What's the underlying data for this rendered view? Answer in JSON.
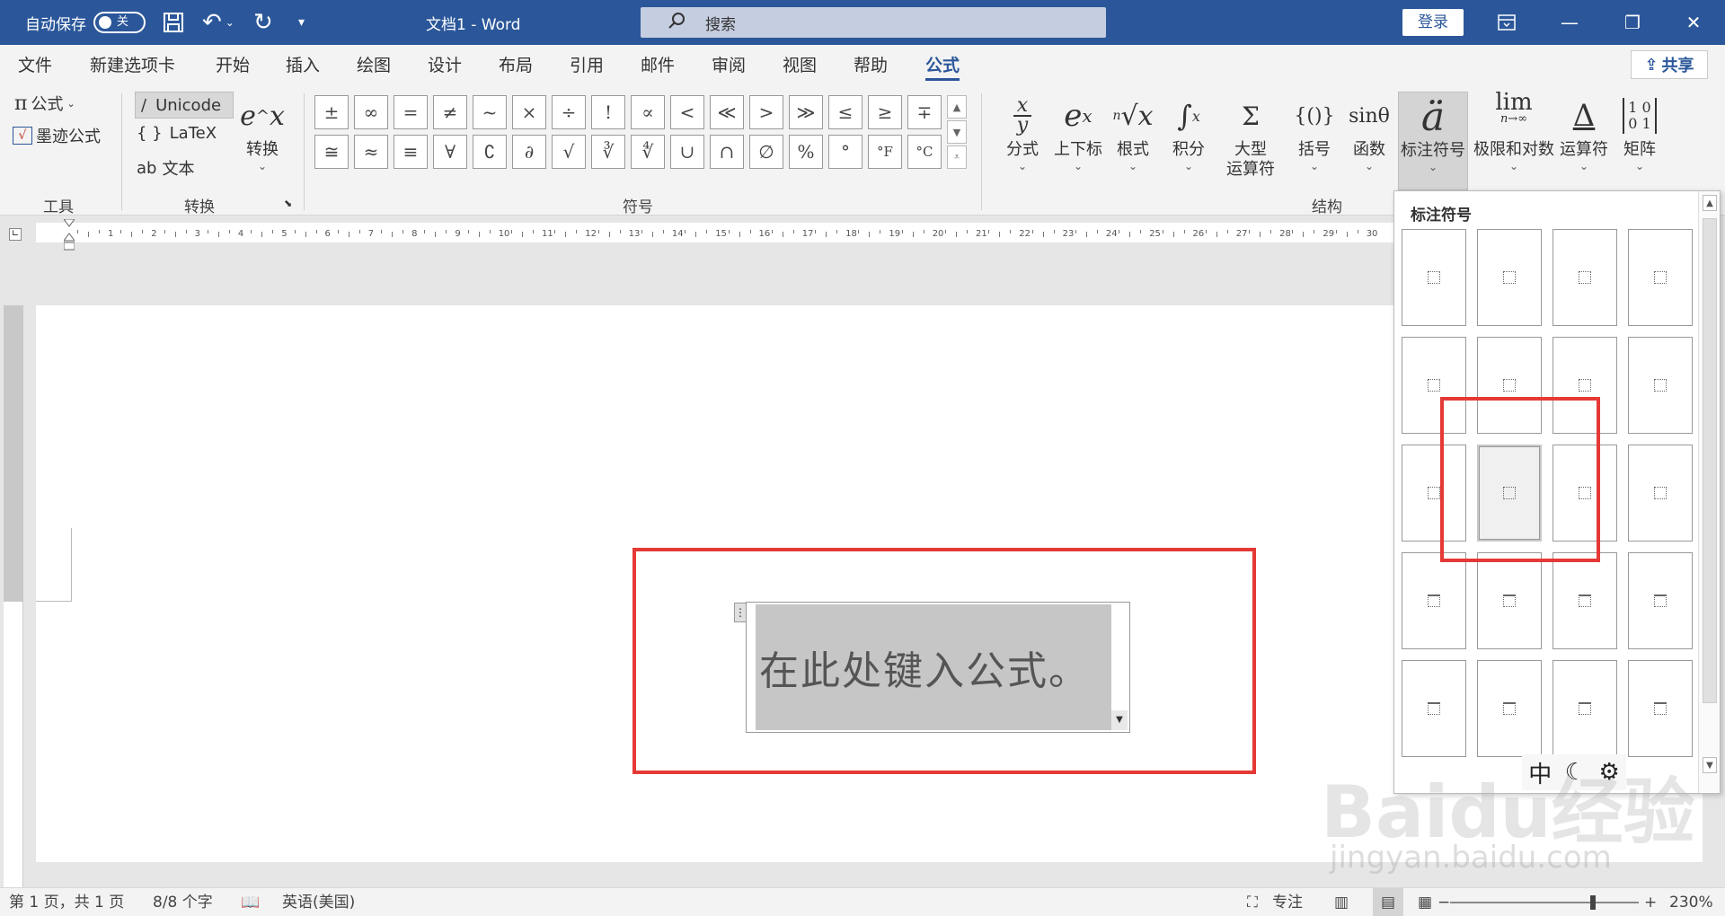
{
  "titlebar": {
    "autosave_label": "自动保存",
    "autosave_state": "关",
    "doc_title": "文档1 - Word",
    "search_placeholder": "搜索",
    "login_label": "登录",
    "colors": {
      "bar": "#2b579a"
    }
  },
  "menu": {
    "tabs": [
      "文件",
      "新建选项卡",
      "开始",
      "插入",
      "绘图",
      "设计",
      "布局",
      "引用",
      "邮件",
      "审阅",
      "视图",
      "帮助",
      "公式"
    ],
    "active_tab": "公式",
    "share_label": "共享"
  },
  "ribbon": {
    "tools": {
      "formula_label": "公式",
      "ink_label": "墨迹公式",
      "group_label": "工具"
    },
    "convert": {
      "unicode_label": "Unicode",
      "latex_label": "LaTeX",
      "text_label": "文本",
      "convert_label": "转换",
      "group_label": "转换"
    },
    "symbols": {
      "row1": [
        "±",
        "∞",
        "=",
        "≠",
        "~",
        "×",
        "÷",
        "!",
        "∝",
        "<",
        "≪",
        ">",
        "≫",
        "≤",
        "≥",
        "∓"
      ],
      "row2": [
        "≅",
        "≈",
        "≡",
        "∀",
        "∁",
        "∂",
        "√",
        "∛",
        "∜",
        "∪",
        "∩",
        "∅",
        "%",
        "°",
        "°F",
        "°C"
      ],
      "group_label": "符号"
    },
    "structures": {
      "items": [
        {
          "glyph": "x/y",
          "label": "分式"
        },
        {
          "glyph": "eˣ",
          "label": "上下标"
        },
        {
          "glyph": "ⁿ√x",
          "label": "根式"
        },
        {
          "glyph": "∫",
          "label": "积分"
        },
        {
          "glyph": "Σ",
          "label": "大型",
          "label2": "运算符"
        },
        {
          "glyph": "{()}",
          "label": "括号"
        },
        {
          "glyph": "sinθ",
          "label": "函数"
        },
        {
          "glyph": "ä",
          "label": "标注符号"
        },
        {
          "glyph": "lim",
          "label": "极限和对数"
        },
        {
          "glyph": "Δ",
          "label": "运算符"
        },
        {
          "glyph": "[10/01]",
          "label": "矩阵"
        }
      ],
      "selected": "标注符号",
      "group_label": "结构"
    }
  },
  "ruler": {
    "ticks": [
      "1",
      "2",
      "3",
      "4",
      "5",
      "6",
      "7",
      "8",
      "9",
      "10",
      "11",
      "12",
      "13",
      "14",
      "15",
      "16",
      "17",
      "18",
      "19",
      "20",
      "21",
      "22",
      "23",
      "24",
      "25",
      "26",
      "27",
      "28",
      "29",
      "30"
    ]
  },
  "document": {
    "equation_placeholder": "在此处键入公式。"
  },
  "gallery": {
    "title": "标注符号",
    "rows": 5,
    "cols": 4,
    "hovered": "row3-col2"
  },
  "ime": {
    "mode": "中"
  },
  "statusbar": {
    "page": "第 1 页，共 1 页",
    "words": "8/8 个字",
    "language": "英语(美国)",
    "focus": "专注",
    "zoom": "230%"
  },
  "watermark": {
    "text": "Baidu经验",
    "url": "jingyan.baidu.com"
  }
}
